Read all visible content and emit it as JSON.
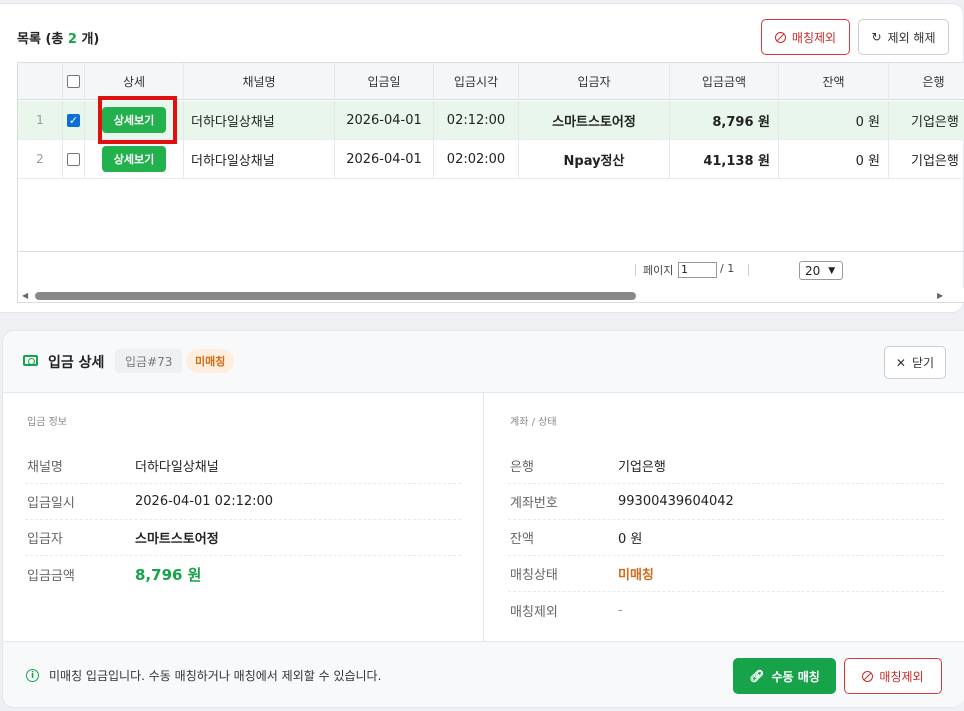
{
  "list": {
    "title_prefix": "목록 (총 ",
    "count": "2",
    "title_suffix": " 개)",
    "exclude_button": "매칭제외",
    "unexclude_button": "제외 해제",
    "columns": [
      "상세",
      "채널명",
      "입금일",
      "입금시각",
      "입금자",
      "입금금액",
      "잔액",
      "은행"
    ],
    "rows": [
      {
        "num": "1",
        "checked": true,
        "detail_button": "상세보기",
        "channel": "더하다일상채널",
        "date": "2026-04-01",
        "time": "02:12:00",
        "depositor": "스마트스토어정",
        "amount": "8,796 원",
        "balance": "0 원",
        "bank": "기업은행"
      },
      {
        "num": "2",
        "checked": false,
        "detail_button": "상세보기",
        "channel": "더하다일상채널",
        "date": "2026-04-01",
        "time": "02:02:00",
        "depositor": "Npay정산",
        "amount": "41,138 원",
        "balance": "0 원",
        "bank": "기업은행"
      }
    ],
    "pager": {
      "page_label": "페이지",
      "page_value": "1",
      "page_total": "/ 1",
      "page_size": "20"
    }
  },
  "detail": {
    "title": "입금 상세",
    "id_badge": "입금#73",
    "status_badge": "미매칭",
    "close_button": "닫기",
    "left_section": "입금 정보",
    "right_section": "계좌 / 상태",
    "left_fields": [
      {
        "label": "채널명",
        "value": "더하다일상채널"
      },
      {
        "label": "입금일시",
        "value": "2026-04-01 02:12:00"
      },
      {
        "label": "입금자",
        "value": "스마트스토어정"
      },
      {
        "label": "입금금액",
        "value": "8,796 원"
      }
    ],
    "right_fields": [
      {
        "label": "은행",
        "value": "기업은행"
      },
      {
        "label": "계좌번호",
        "value": "99300439604042"
      },
      {
        "label": "잔액",
        "value": "0 원"
      },
      {
        "label": "매칭상태",
        "value": "미매칭"
      },
      {
        "label": "매칭제외",
        "value": "-"
      }
    ],
    "footer_message": "미매칭 입금입니다. 수동 매칭하거나 매칭에서 제외할 수 있습니다.",
    "manual_match_button": "수동 매칭",
    "exclude_button": "매칭제외"
  },
  "colors": {
    "green": "#16a34a",
    "red": "#d83a3a",
    "orange": "#d26a18",
    "selected_row": "#e8f6ec"
  }
}
